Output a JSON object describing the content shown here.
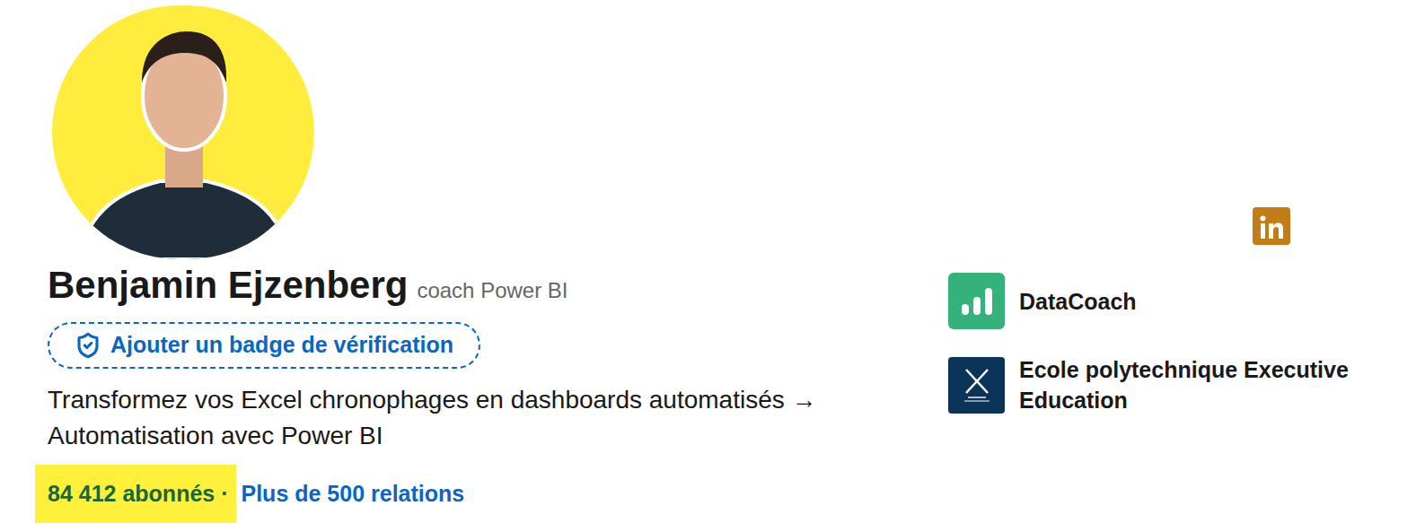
{
  "profile": {
    "name": "Benjamin Ejzenberg",
    "title": "coach Power BI",
    "photo": "photo"
  },
  "verification_button": {
    "label": "Ajouter un badge de vérification"
  },
  "headline": "Transformez vos Excel chronophages en dashboards automatisés → Automatisation avec Power BI",
  "stats": {
    "followers": "84 412 abonnés",
    "separator": "·",
    "connections": "Plus de 500 relations",
    "followers_highlighted": true
  },
  "organizations": [
    {
      "name": "DataCoach",
      "color": "#34b27b",
      "kind": "datacoach"
    },
    {
      "name": "Ecole polytechnique Executive Education",
      "color": "#0b3558",
      "kind": "polytechnique"
    }
  ]
}
